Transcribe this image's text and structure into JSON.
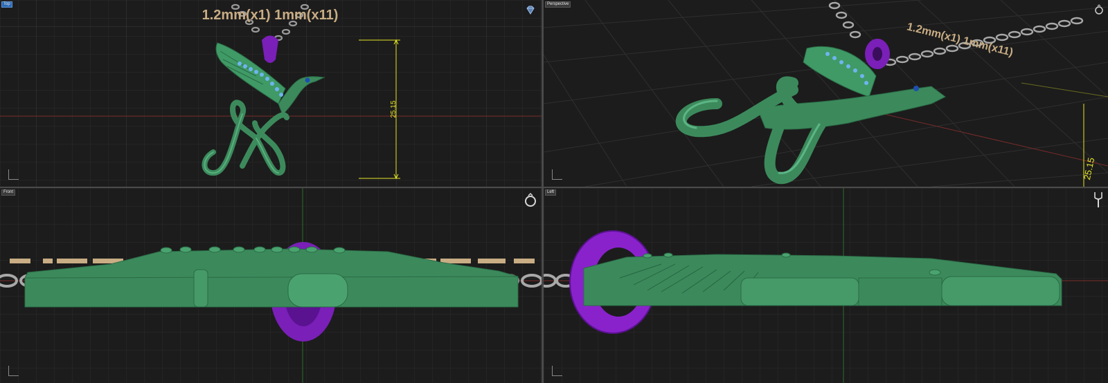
{
  "viewports": {
    "top": {
      "label": "Top",
      "annotation": "1.2mm(x1) 1mm(x11)",
      "dimension": "25.15"
    },
    "perspective": {
      "label": "Perspective",
      "annotation": "1.2mm(x1) 1mm(x11)",
      "dimension": "25.15"
    },
    "front": {
      "label": "Front"
    },
    "left": {
      "label": "Left"
    }
  },
  "colors": {
    "viewport_bg": "#1c1c1c",
    "grid": "#2e2e2e",
    "pendant_green": "#3c8a5c",
    "bail_purple": "#7a1fb8",
    "annotation_tan": "#c9ad84",
    "dimension_yellow": "#e6e62a",
    "gem_blue": "#6fb4f0"
  },
  "icons": [
    "gem-icon",
    "ring-icon",
    "tuning-fork-icon"
  ]
}
